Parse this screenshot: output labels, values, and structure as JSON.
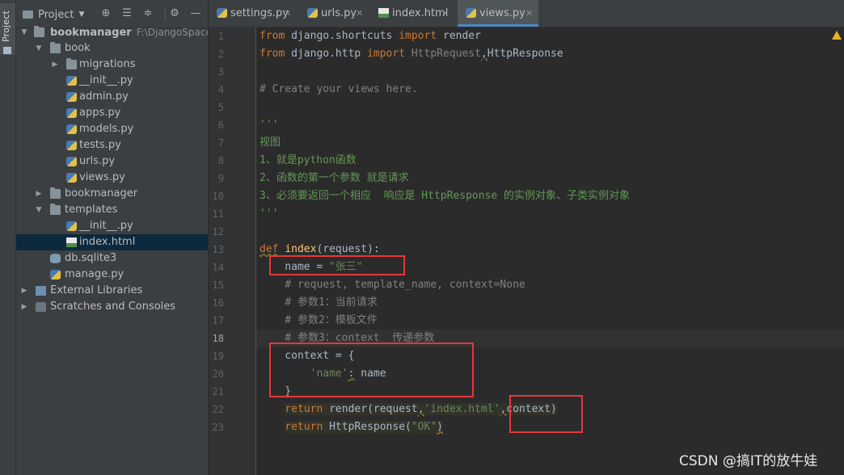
{
  "toolwindow": {
    "tab_label": "Project"
  },
  "project_panel": {
    "title": "Project",
    "buttons": [
      "locate-icon",
      "expand-all-icon",
      "collapse-all-icon",
      "gear-icon",
      "hide-icon"
    ],
    "tree": [
      {
        "label": "bookmanager",
        "path": "F:\\DjangoSpace\\b",
        "icon": "folder",
        "expanded": true,
        "level": 0,
        "bold": true
      },
      {
        "label": "book",
        "icon": "folder",
        "expanded": true,
        "level": 1
      },
      {
        "label": "migrations",
        "icon": "folder",
        "expanded": false,
        "level": 2
      },
      {
        "label": "__init__.py",
        "icon": "py",
        "level": 3
      },
      {
        "label": "admin.py",
        "icon": "py",
        "level": 3
      },
      {
        "label": "apps.py",
        "icon": "py",
        "level": 3
      },
      {
        "label": "models.py",
        "icon": "py",
        "level": 3
      },
      {
        "label": "tests.py",
        "icon": "py",
        "level": 3
      },
      {
        "label": "urls.py",
        "icon": "py",
        "level": 3
      },
      {
        "label": "views.py",
        "icon": "py",
        "level": 3
      },
      {
        "label": "bookmanager",
        "icon": "folder",
        "expanded": false,
        "level": 1
      },
      {
        "label": "templates",
        "icon": "folder",
        "expanded": true,
        "level": 1
      },
      {
        "label": "__init__.py",
        "icon": "py",
        "level": 3
      },
      {
        "label": "index.html",
        "icon": "html",
        "level": 3,
        "selected": true
      },
      {
        "label": "db.sqlite3",
        "icon": "db",
        "level": 2
      },
      {
        "label": "manage.py",
        "icon": "py",
        "level": 2
      },
      {
        "label": "External Libraries",
        "icon": "lib",
        "expanded": false,
        "level": 0
      },
      {
        "label": "Scratches and Consoles",
        "icon": "console",
        "expanded": false,
        "level": 0
      }
    ]
  },
  "editor_tabs": [
    {
      "label": "settings.py",
      "icon": "py",
      "active": false
    },
    {
      "label": "urls.py",
      "icon": "py",
      "active": false
    },
    {
      "label": "index.html",
      "icon": "html",
      "active": false
    },
    {
      "label": "views.py",
      "icon": "py",
      "active": true
    }
  ],
  "editor": {
    "current_line": 18,
    "line_numbers": [
      "1",
      "2",
      "3",
      "4",
      "5",
      "6",
      "7",
      "8",
      "9",
      "10",
      "11",
      "12",
      "13",
      "14",
      "15",
      "16",
      "17",
      "18",
      "19",
      "20",
      "21",
      "22",
      "23"
    ],
    "code": {
      "l1_kw1": "from",
      "l1_mod": " django.shortcuts ",
      "l1_kw2": "import",
      "l1_name": " render",
      "l2_kw1": "from",
      "l2_mod": " django.http ",
      "l2_kw2": "import",
      "l2_n1": " HttpRequest",
      "l2_comma": ",",
      "l2_n2": "HttpResponse",
      "l4": "# Create your views here.",
      "l6": "'''",
      "l7": "视图",
      "l8": "1、就是python函数",
      "l9": "2、函数的第一个参数 就是请求",
      "l10": "3、必须要返回一个相应  响应是 HttpResponse 的实例对象、子类实例对象",
      "l11": "'''",
      "l13_kw": "def",
      "l13_fn": "index",
      "l13_rest": "(request):",
      "l14_a": "    name = ",
      "l14_str": "\"张三\"",
      "l15": "    # request, template_name, context=None",
      "l16": "    # 参数1：当前请求",
      "l17": "    # 参数2：模板文件",
      "l18": "    # 参数3：context  传递参数",
      "l19": "    context = {",
      "l20_a": "        ",
      "l20_str": "'name'",
      "l20_b": ":",
      "l20_c": " name",
      "l21": "    }",
      "l22_ind": "    ",
      "l22_kw": "return",
      "l22_a": " render(request",
      "l22_c1": ",",
      "l22_str": "'index.html'",
      "l22_c2": ",",
      "l22_b": "context)",
      "l23_ind": "    ",
      "l23_kw": "return",
      "l23_a": " HttpResponse(",
      "l23_str": "\"OK\"",
      "l23_b": ")"
    }
  },
  "watermark": "CSDN @搞IT的放牛娃",
  "colors": {
    "keyword": "#cc7832",
    "function": "#ffc66d",
    "string": "#6a8759",
    "comment": "#808080",
    "annotation_box": "#e5373a"
  }
}
